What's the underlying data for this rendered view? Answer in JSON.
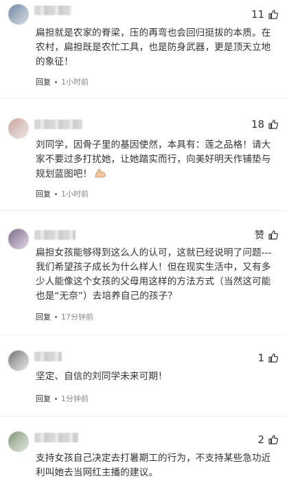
{
  "comments": [
    {
      "likes": "11",
      "text": "扁担就是农家的脊梁，压的再弯也会回归挺拔的本质。在农村，扁担既是农忙工具，也是防身武器，更是顶天立地的象征！",
      "reply": "回复",
      "time": "1小时前"
    },
    {
      "likes": "18",
      "text": "刘同学，因骨子里的基因使然，本具有：莲之品格！请大家不要过多打扰她，让她踏实而行，向美好明天作铺垫与规划蓝图吧！",
      "emoji": "flexed-biceps",
      "reply": "回复",
      "time": "1小时前"
    },
    {
      "likes": "赞",
      "text": "扁担女孩能够得到这么人的认可，这就已经说明了问题---我们希望孩子成长为什么样人！但在现实生活中，又有多少人能像这个女孩的父母用这样的方法方式（当然这可能也是“无奈”）去培养自己的孩子？",
      "reply": "回复",
      "time": "17分钟前"
    },
    {
      "likes": "1",
      "text": "坚定、自信的刘同学未来可期！",
      "reply": "回复",
      "time": "1分钟前"
    },
    {
      "likes": "2",
      "text": "支持女孩自己决定去打暑期工的行为，不支持某些急功近利叫她去当网红主播的建议。"
    }
  ],
  "icons": {
    "like": "thumbs-up-icon"
  },
  "colors": {
    "text": "#333333",
    "meta": "#888888",
    "divider": "#eeeeee"
  }
}
